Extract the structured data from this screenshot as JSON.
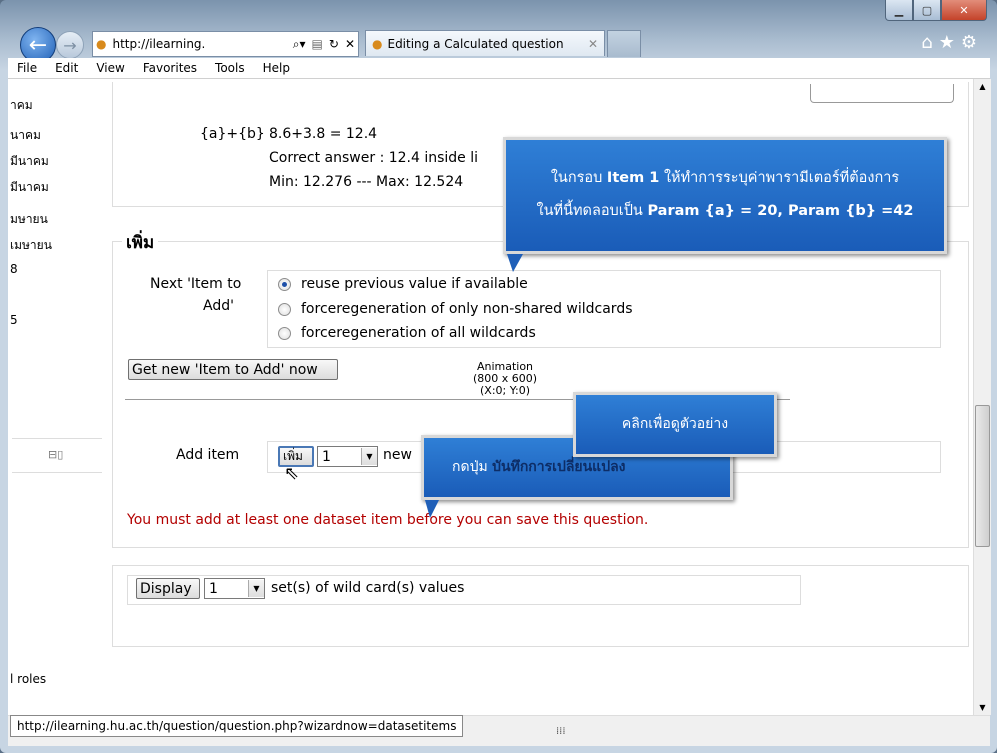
{
  "browser": {
    "address": "http://ilearning.",
    "tab_title": "Editing a Calculated question",
    "status_url": "http://ilearning.hu.ac.th/question/question.php?wizardnow=datasetitems"
  },
  "menu": [
    "File",
    "Edit",
    "View",
    "Favorites",
    "Tools",
    "Help"
  ],
  "left_nav": [
    "าคม",
    "นาคม",
    "มีนาคม",
    "มีนาคม",
    "มษายน",
    "เมษายน",
    "8",
    "5"
  ],
  "left_nav_bottom": "l roles",
  "formula": {
    "expr": "{a}+{b}",
    "calc": "8.6+3.8 = 12.4",
    "correct": "Correct answer : 12.4 inside li",
    "minmax": "Min: 12.276 --- Max: 12.524"
  },
  "add_section": {
    "legend": "เพิ่ม",
    "next_label_1": "Next 'Item to",
    "next_label_2": "Add'",
    "options": [
      "reuse previous value if available",
      "forceregeneration of only non-shared wildcards",
      "forceregeneration of all wildcards"
    ],
    "get_new_button": "Get new 'Item to Add' now",
    "add_item_label": "Add item",
    "add_button": "เพิ่ม",
    "add_count": "1",
    "add_suffix": "new",
    "error": "You must add at least one dataset item before you can save this question."
  },
  "animation": {
    "l1": "Animation",
    "l2": "(800 x 600)",
    "l3": "(X:0; Y:0)"
  },
  "display_section": {
    "button": "Display",
    "count": "1",
    "suffix": "set(s) of wild card(s) values"
  },
  "callouts": {
    "main_l1_pre": "ในกรอบ ",
    "main_l1_bold": "Item 1",
    "main_l1_post": " ให้ทำการระบุค่าพารามีเตอร์ที่ต้องการ",
    "main_l2_pre": "ในที่นี้ทดลอบเป็น ",
    "main_l2_bold": "Param {a} = 20, Param {b} =42",
    "click": "คลิกเพื่อดูตัวอย่าง",
    "press_pre": "กดปุ่ม ",
    "press_bold": "บันทึกการเปลี่ยนแปลง"
  },
  "colors": {
    "error": "#b30000",
    "callout": "#1f66c4"
  }
}
